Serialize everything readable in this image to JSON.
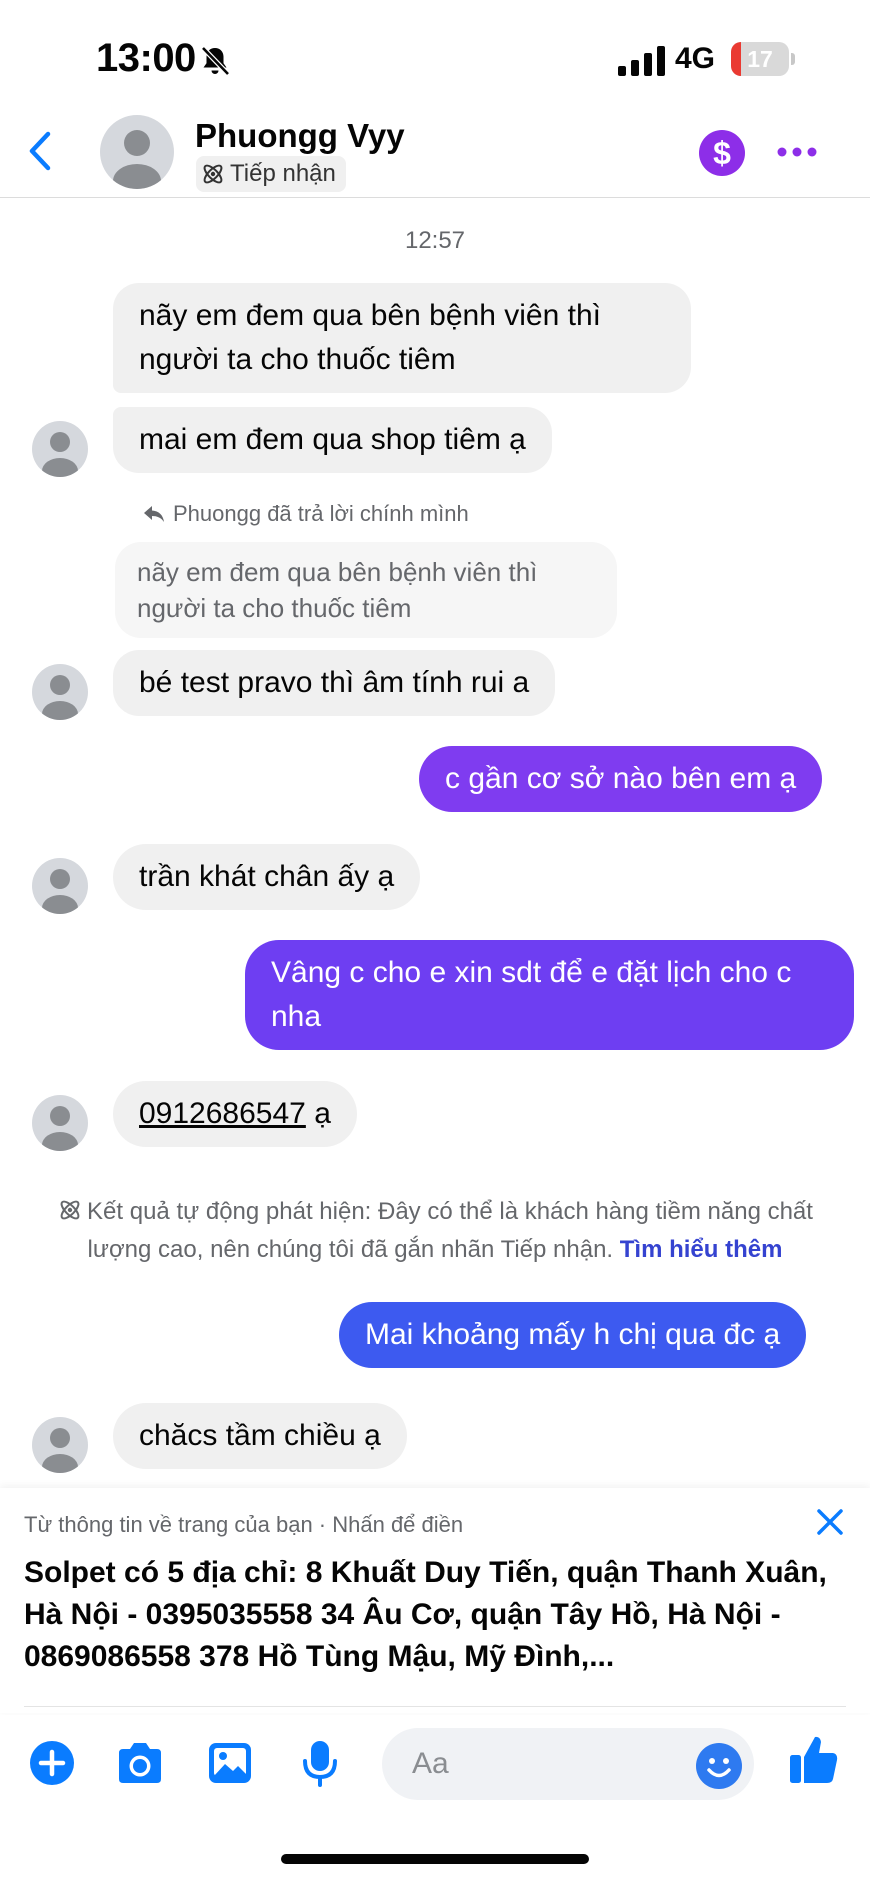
{
  "status_bar": {
    "time": "13:00",
    "network": "4G",
    "battery_percent": "17",
    "battery_level": 0.17
  },
  "header": {
    "contact_name": "Phuongg Vyy",
    "contact_label": "Tiếp nhận",
    "accent_color": "#0a7cff",
    "payment_color": "#8d2ee8"
  },
  "conversation": {
    "timestamp": "12:57",
    "msg1": "nãy em đem qua bên bệnh viên thì người ta cho thuốc tiêm",
    "msg2": "mai em đem qua shop tiêm ạ",
    "reply_note": "Phuongg đã trả lời chính mình",
    "quoted": "nãy em đem qua bên bệnh viên thì người ta cho thuốc tiêm",
    "msg3": "bé test pravo thì âm tính rui a",
    "out1": "c gần cơ sở nào bên em ạ",
    "msg4": "trần khát chân ấy ạ",
    "out2": "Vâng c cho e xin sdt để e đặt lịch cho c nha",
    "phone": "0912686547",
    "phone_suffix": " ạ",
    "auto_notice": "Kết quả tự động phát hiện: Đây có thể là khách hàng tiềm năng chất lượng cao, nên chúng tôi đã gắn nhãn Tiếp nhận.",
    "learn_more": "Tìm hiểu thêm",
    "out3": "Mai khoảng mấy h chị qua đc ạ",
    "msg5": "chăcs tầm chiều ạ",
    "outgoing_colors": [
      "#7f3cf0",
      "#6e3ef2",
      "#5a48f2",
      "#3d5af0"
    ]
  },
  "suggestion": {
    "hint": "Từ thông tin về trang của bạn · Nhấn để điền",
    "text": "Solpet có 5 địa chỉ: 8 Khuất Duy Tiến, quận Thanh Xuân, Hà Nội - 0395035558 34 Âu Cơ, quận Tây Hồ, Hà Nội - 0869086558 378 Hồ Tùng Mậu, Mỹ Đình,..."
  },
  "composer": {
    "placeholder": "Aa",
    "icons": [
      "plus-icon",
      "camera-icon",
      "gallery-icon",
      "microphone-icon",
      "emoji-icon",
      "thumbs-up-icon"
    ]
  }
}
